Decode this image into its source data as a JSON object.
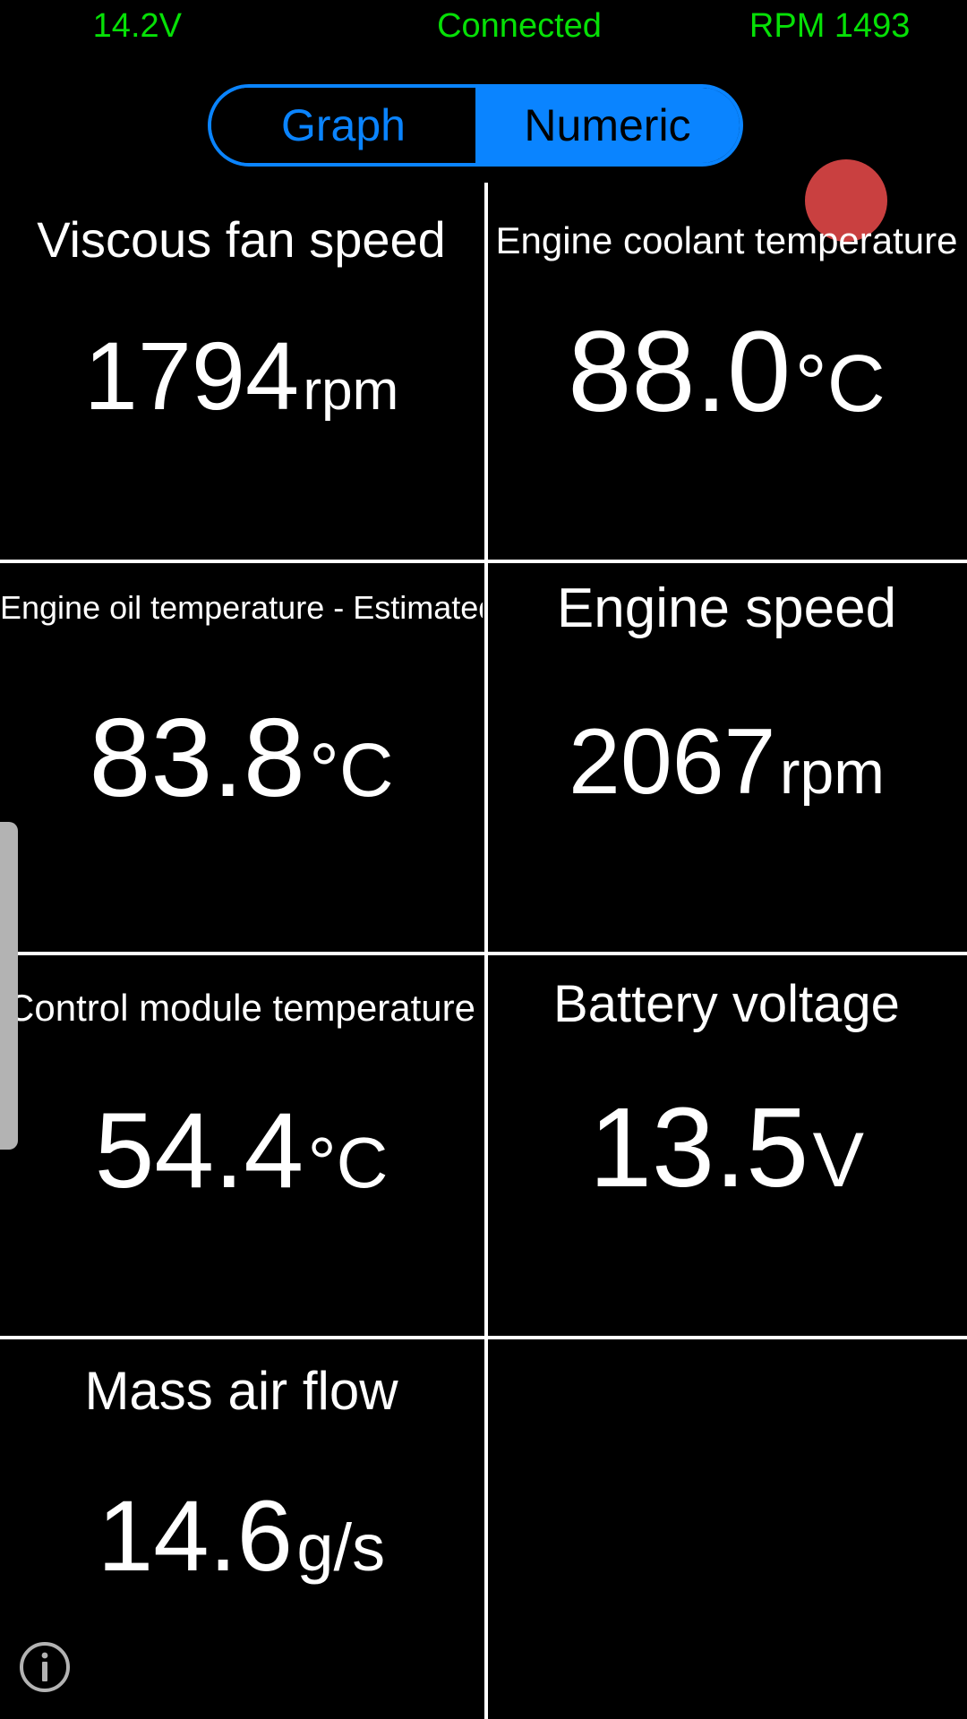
{
  "status_bar": {
    "voltage": "14.2V",
    "connection": "Connected",
    "rpm": "RPM 1493",
    "color": "#06e006"
  },
  "toolbar": {
    "segmented": {
      "options": [
        {
          "label": "Graph",
          "selected": false
        },
        {
          "label": "Numeric",
          "selected": true
        }
      ],
      "accent_color": "#0a84ff"
    },
    "record_button": {
      "name": "record-button",
      "color": "#c94040"
    }
  },
  "gauges": [
    {
      "title": "Viscous fan speed",
      "value": "1794",
      "unit": "rpm"
    },
    {
      "title": "Engine coolant temperature",
      "value": "88.0",
      "unit": "°C"
    },
    {
      "title": "Engine oil temperature  -  Estimated",
      "value": "83.8",
      "unit": "°C"
    },
    {
      "title": "Engine speed",
      "value": "2067",
      "unit": "rpm"
    },
    {
      "title": "Control module temperature",
      "value": "54.4",
      "unit": "°C"
    },
    {
      "title": "Battery voltage",
      "value": "13.5",
      "unit": "V"
    },
    {
      "title": "Mass air flow",
      "value": "14.6",
      "unit": "g/s"
    },
    {
      "title": "",
      "value": "",
      "unit": ""
    }
  ],
  "overlay": {
    "info_icon": "info-icon",
    "info_icon_color": "#b3b3b3",
    "drawer_handle": "drawer-handle",
    "drawer_handle_color": "#b3b3b3"
  }
}
